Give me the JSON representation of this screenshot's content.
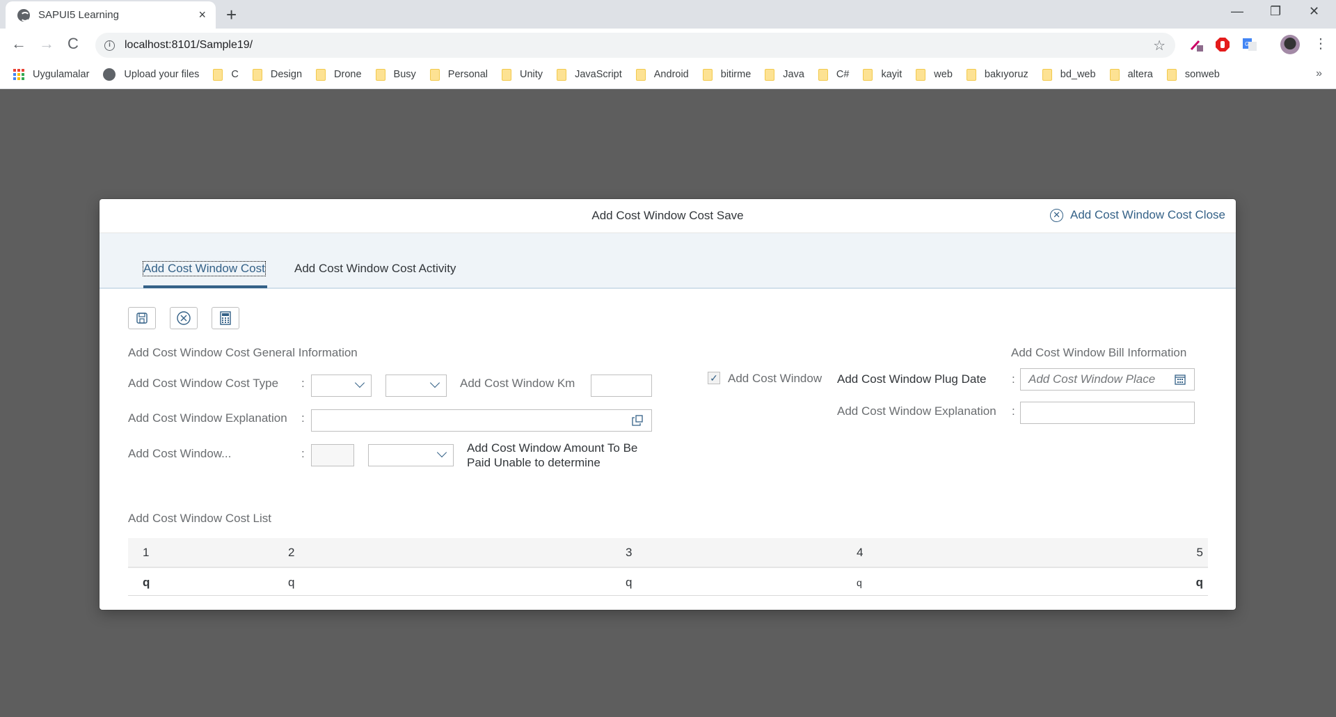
{
  "browser": {
    "tab_title": "SAPUI5 Learning",
    "url": "localhost:8101/Sample19/",
    "bookmarks": [
      "Uygulamalar",
      "Upload your files",
      "C",
      "Design",
      "Drone",
      "Busy",
      "Personal",
      "Unity",
      "JavaScript",
      "Android",
      "bitirme",
      "Java",
      "C#",
      "kayit",
      "web",
      "bakıyoruz",
      "bd_web",
      "altera",
      "sonweb"
    ],
    "bookmarks_more": "»",
    "icons": {
      "back": "←",
      "forward": "→",
      "reload": "C",
      "star": "☆",
      "menu": "⋮",
      "new_tab": "+",
      "close_tab": "×",
      "minimize": "—",
      "restore": "❐",
      "close_window": "✕",
      "info": "i"
    }
  },
  "dialog": {
    "title": "Add Cost Window Cost Save",
    "close_label": "Add Cost Window Cost Close",
    "tabs": [
      {
        "label": "Add Cost Window Cost",
        "selected": true
      },
      {
        "label": "Add Cost Window Cost Activity",
        "selected": false
      }
    ],
    "toolbar": {
      "save": "save-icon",
      "cancel": "cancel-icon",
      "calculator": "calculator-icon"
    },
    "general": {
      "title": "Add Cost Window Cost General Information",
      "cost_type_label": "Add Cost Window Cost Type",
      "km_label": "Add Cost Window Km",
      "explanation_label": "Add Cost Window Explanation",
      "window_label": "Add Cost Window...",
      "amount_label": "Add Cost Window Amount To Be Paid Unable to determine",
      "colon": ":"
    },
    "checkbox": {
      "label": "Add Cost Window",
      "checked": true,
      "mark": "✓"
    },
    "bill": {
      "title": "Add Cost Window Bill Information",
      "plug_date_label": "Add Cost Window Plug Date",
      "plug_date_placeholder": "Add Cost Window Place",
      "explanation_label": "Add Cost Window Explanation"
    },
    "list": {
      "title": "Add Cost Window Cost List",
      "columns": [
        "1",
        "2",
        "3",
        "4",
        "5"
      ],
      "rows": [
        [
          "q",
          "q",
          "q",
          "q",
          "q"
        ]
      ]
    }
  }
}
